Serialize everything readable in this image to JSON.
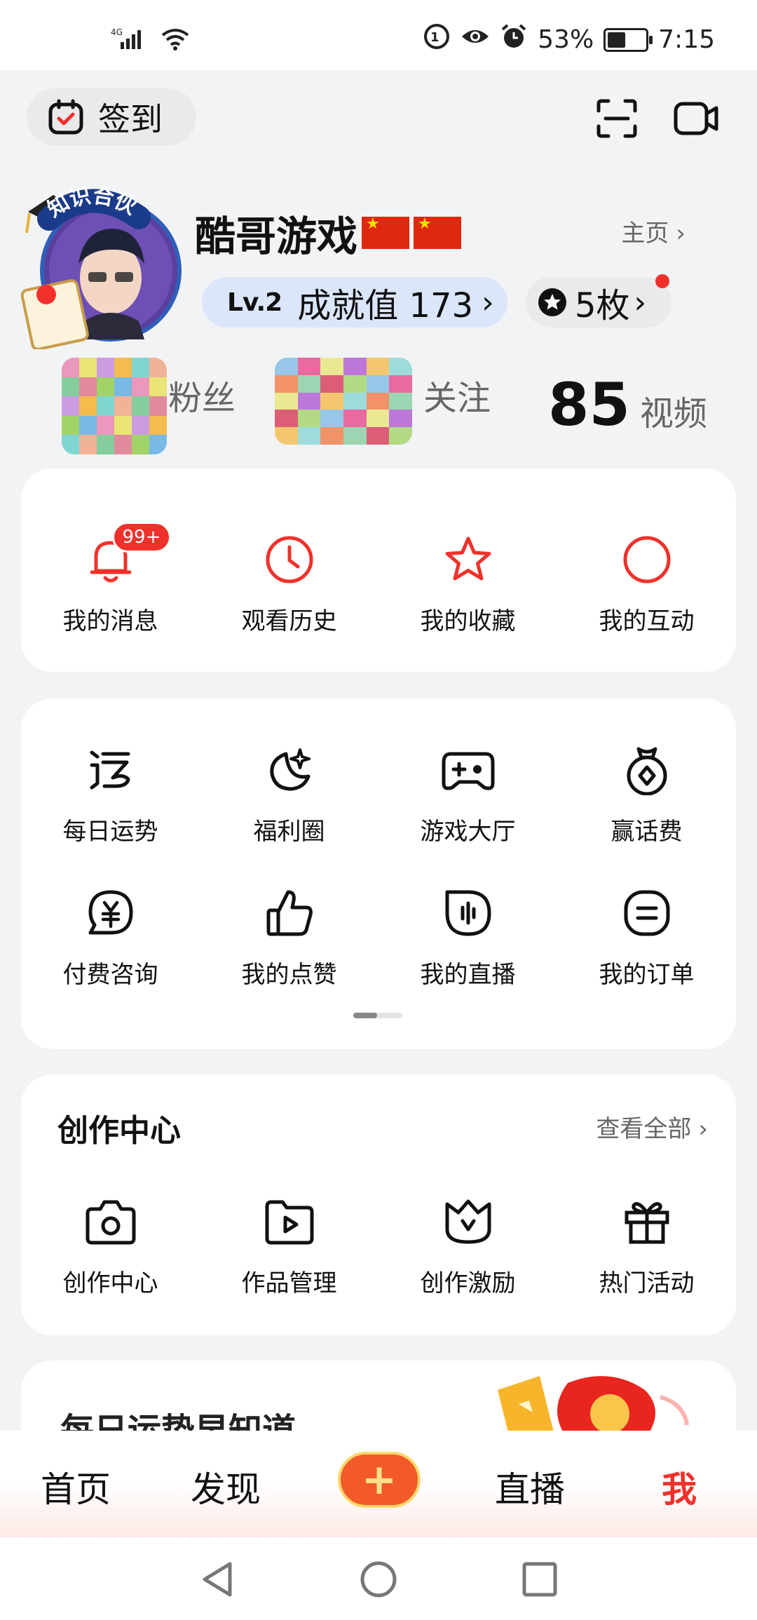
{
  "status_bar": {
    "network": "4G",
    "battery": "53%",
    "battery_level": 0.53,
    "time": "7:15",
    "icons": [
      "signal-icon",
      "wifi-icon",
      "hd-call-icon",
      "eye-comfort-icon",
      "alarm-icon",
      "battery-icon"
    ]
  },
  "top_bar": {
    "checkin_label": "签到",
    "icons": [
      "calendar-check-icon",
      "scan-icon",
      "video-camera-icon"
    ]
  },
  "profile": {
    "avatar_badge_text": "知识合伙人",
    "username": "酷哥游戏",
    "homepage_link": "主页",
    "level": "Lv.2",
    "achievement_text": "成就值 173",
    "medals_text": "5枚",
    "stats": [
      {
        "value": "",
        "label": "粉丝",
        "obscured": true
      },
      {
        "value": "",
        "label": "关注",
        "obscured": true
      },
      {
        "value": "85",
        "label": "视频",
        "obscured": false
      }
    ]
  },
  "quick_actions": [
    {
      "label": "我的消息",
      "icon": "bell-icon",
      "badge": "99+"
    },
    {
      "label": "观看历史",
      "icon": "clock-icon"
    },
    {
      "label": "我的收藏",
      "icon": "star-icon"
    },
    {
      "label": "我的互动",
      "icon": "circle-icon"
    }
  ],
  "services": {
    "items": [
      {
        "label": "每日运势",
        "icon": "fortune-icon"
      },
      {
        "label": "福利圈",
        "icon": "moon-sparkle-icon"
      },
      {
        "label": "游戏大厅",
        "icon": "gamepad-icon"
      },
      {
        "label": "赢话费",
        "icon": "money-bag-icon"
      },
      {
        "label": "付费咨询",
        "icon": "yuan-chat-icon"
      },
      {
        "label": "我的点赞",
        "icon": "thumbs-up-icon"
      },
      {
        "label": "我的直播",
        "icon": "live-icon"
      },
      {
        "label": "我的订单",
        "icon": "order-icon"
      }
    ],
    "page_index": 1,
    "page_count": 2
  },
  "creator_center": {
    "title": "创作中心",
    "see_all": "查看全部",
    "items": [
      {
        "label": "创作中心",
        "icon": "camera-icon"
      },
      {
        "label": "作品管理",
        "icon": "video-play-icon"
      },
      {
        "label": "创作激励",
        "icon": "crown-icon"
      },
      {
        "label": "热门活动",
        "icon": "gift-icon"
      }
    ]
  },
  "promo": {
    "title": "每日运势早知道"
  },
  "bottom_nav": {
    "items": [
      "首页",
      "发现",
      "直播",
      "我"
    ],
    "plus_label": "+",
    "active": "我"
  },
  "colors": {
    "accent_red": "#f0312b",
    "page_bg": "#f2f3f5",
    "level_pill_bg": "#dbe6fb",
    "pill_grey": "#e9eaec"
  }
}
